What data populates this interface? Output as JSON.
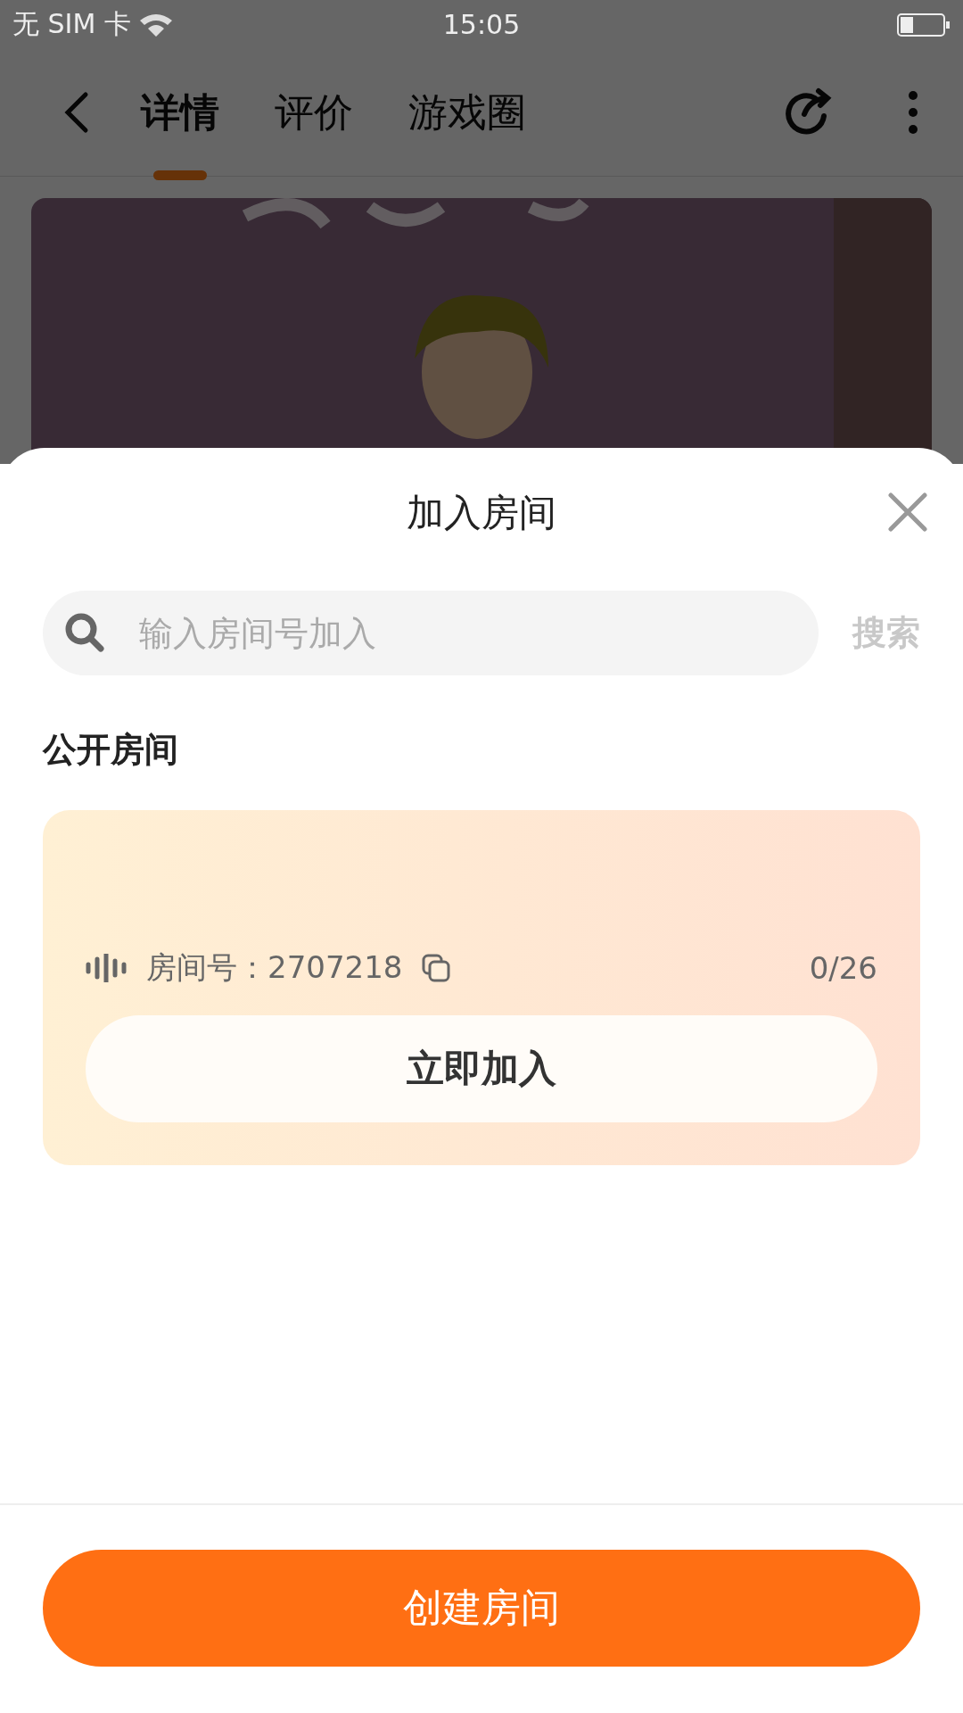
{
  "status_bar": {
    "carrier": "无 SIM 卡",
    "time": "15:05"
  },
  "nav": {
    "tabs": [
      {
        "label": "详情",
        "selected": true
      },
      {
        "label": "评价",
        "selected": false
      },
      {
        "label": "游戏圈",
        "selected": false
      }
    ]
  },
  "sheet": {
    "title": "加入房间",
    "search": {
      "placeholder": "输入房间号加入",
      "button": "搜索"
    },
    "section_title": "公开房间",
    "rooms": [
      {
        "room_label": "房间号：",
        "room_number": "2707218",
        "occupancy": "0/26",
        "join_button": "立即加入"
      }
    ],
    "create_button": "创建房间"
  }
}
